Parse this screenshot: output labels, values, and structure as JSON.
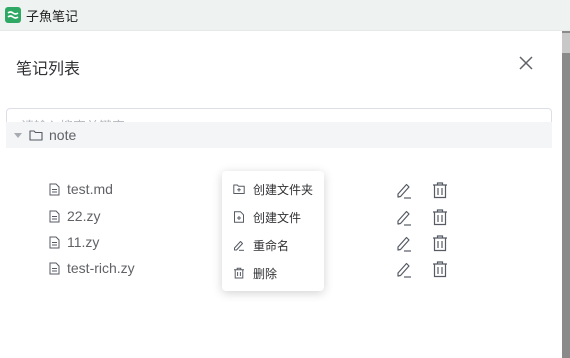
{
  "window": {
    "title": "子魚笔记",
    "app_icon": "app-logo-icon"
  },
  "dialog": {
    "title": "笔记列表",
    "close_icon": "close-icon",
    "search_placeholder": "请输入搜索关键字",
    "search_value": ""
  },
  "tree": {
    "root": {
      "label": "note",
      "icon": "folder-icon",
      "expanded": true
    },
    "files": [
      {
        "label": "test.md",
        "icon": "file-icon"
      },
      {
        "label": "22.zy",
        "icon": "file-icon"
      },
      {
        "label": "11.zy",
        "icon": "file-icon"
      },
      {
        "label": "test-rich.zy",
        "icon": "file-icon"
      }
    ],
    "row_actions": [
      "edit-icon",
      "delete-icon"
    ]
  },
  "context_menu": {
    "items": [
      {
        "label": "创建文件夹",
        "icon": "folder-plus-icon"
      },
      {
        "label": "创建文件",
        "icon": "file-plus-icon"
      },
      {
        "label": "重命名",
        "icon": "pencil-icon"
      },
      {
        "label": "删除",
        "icon": "trash-icon"
      }
    ]
  },
  "colors": {
    "titlebar_bg": "#eef2f1",
    "app_icon_green": "#2fa866",
    "tree_highlight": "#f3f5f7",
    "text": "#606266",
    "icon": "#555a63"
  }
}
